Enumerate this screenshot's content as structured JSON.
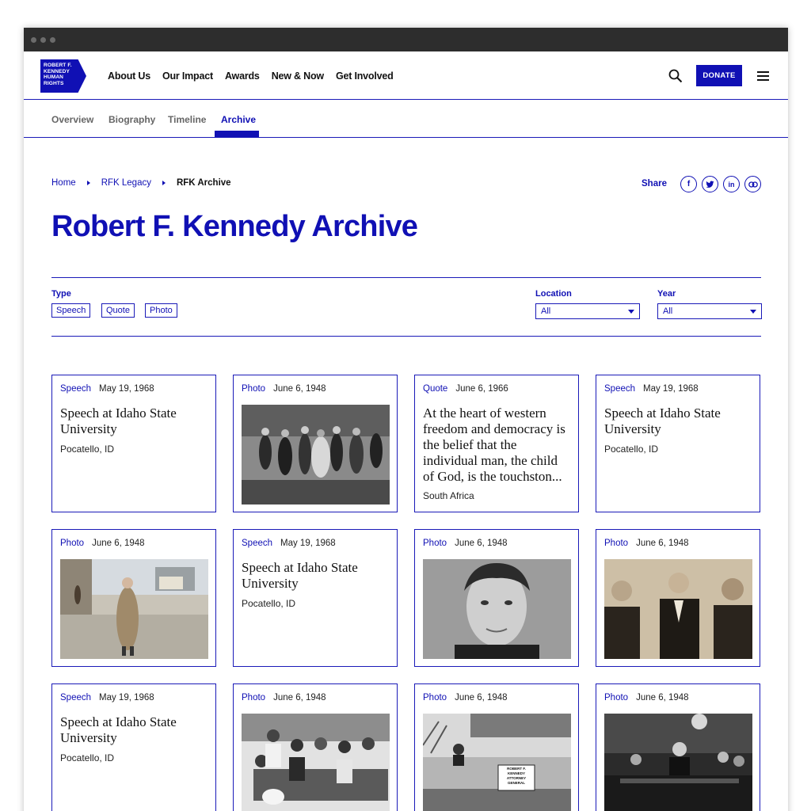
{
  "site": {
    "logo_lines": [
      "ROBERT F.",
      "KENNEDY",
      "HUMAN",
      "RIGHTS"
    ],
    "menu": [
      "About Us",
      "Our Impact",
      "Awards",
      "New & Now",
      "Get Involved"
    ],
    "donate_label": "DONATE"
  },
  "subnav": {
    "tabs": [
      "Overview",
      "Biography",
      "Timeline",
      "Archive"
    ],
    "active": "Archive"
  },
  "breadcrumb": {
    "items": [
      "Home",
      "RFK Legacy",
      "RFK Archive"
    ]
  },
  "share": {
    "label": "Share",
    "icons": [
      "facebook-icon",
      "twitter-icon",
      "linkedin-icon",
      "link-icon"
    ]
  },
  "page_title": "Robert F. Kennedy Archive",
  "filters": {
    "type_label": "Type",
    "type_options": [
      "Speech",
      "Quote",
      "Photo"
    ],
    "location_label": "Location",
    "location_value": "All",
    "year_label": "Year",
    "year_value": "All"
  },
  "cards": [
    {
      "type": "Speech",
      "date": "May 19, 1968",
      "title": "Speech at Idaho State University",
      "location": "Pocatello, ID"
    },
    {
      "type": "Photo",
      "date": "June 6, 1948",
      "image": "crowd-outdoors-bw"
    },
    {
      "type": "Quote",
      "date": "June 6, 1966",
      "title": "At the heart of western freedom and democracy is the belief that the individual man, the child of God, is the touchston...",
      "location": "South Africa"
    },
    {
      "type": "Speech",
      "date": "May 19, 1968",
      "title": "Speech at Idaho State University",
      "location": "Pocatello, ID"
    },
    {
      "type": "Photo",
      "date": "June 6, 1948",
      "image": "man-in-coat-street-color"
    },
    {
      "type": "Speech",
      "date": "May 19, 1968",
      "title": "Speech at Idaho State University",
      "location": "Pocatello, ID"
    },
    {
      "type": "Photo",
      "date": "June 6, 1948",
      "image": "portrait-bw"
    },
    {
      "type": "Photo",
      "date": "June 6, 1948",
      "image": "three-men-sepia"
    },
    {
      "type": "Speech",
      "date": "May 19, 1968",
      "title": "Speech at Idaho State University",
      "location": "Pocatello, ID"
    },
    {
      "type": "Photo",
      "date": "June 6, 1948",
      "image": "family-group-bw"
    },
    {
      "type": "Photo",
      "date": "June 6, 1948",
      "image": "car-motorcade-bw",
      "sign_text": [
        "ROBERT F.",
        "KENNEDY",
        "ATTORNEY",
        "GENERAL"
      ]
    },
    {
      "type": "Photo",
      "date": "June 6, 1948",
      "image": "hearing-room-bw"
    }
  ]
}
